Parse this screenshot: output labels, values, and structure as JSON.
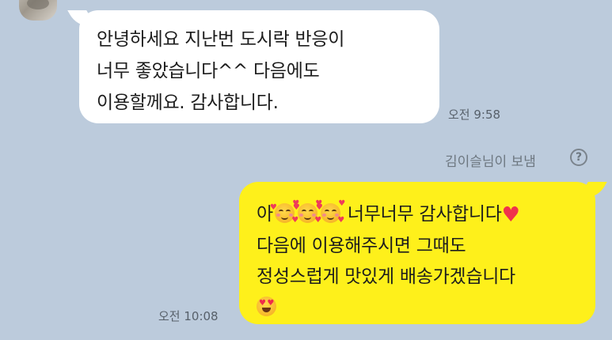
{
  "incoming_message": {
    "text": "안녕하세요 지난번 도시락 반응이\n너무 좋았습니다^^  다음에도\n이용할께요. 감사합니다.",
    "time": "오전 9:58"
  },
  "sent_note": "김이슬님이 보냄",
  "outgoing_message": {
    "line1_prefix": "아",
    "line1_text": "너무너무 감사합니다",
    "line2": "다음에 이용해주시면 그때도",
    "line3": "정성스럽게 맛있게 배송가겠습니다",
    "time": "오전 10:08",
    "emoji_line1": [
      "smiling-face-with-hearts-icon",
      "smiling-face-with-hearts-icon",
      "smiling-face-with-hearts-icon",
      "red-heart-icon"
    ],
    "emoji_line4": [
      "heart-eyes-face-icon"
    ]
  },
  "colors": {
    "background": "#bccbdc",
    "incoming_bubble": "#ffffff",
    "outgoing_bubble": "#fef01b"
  }
}
